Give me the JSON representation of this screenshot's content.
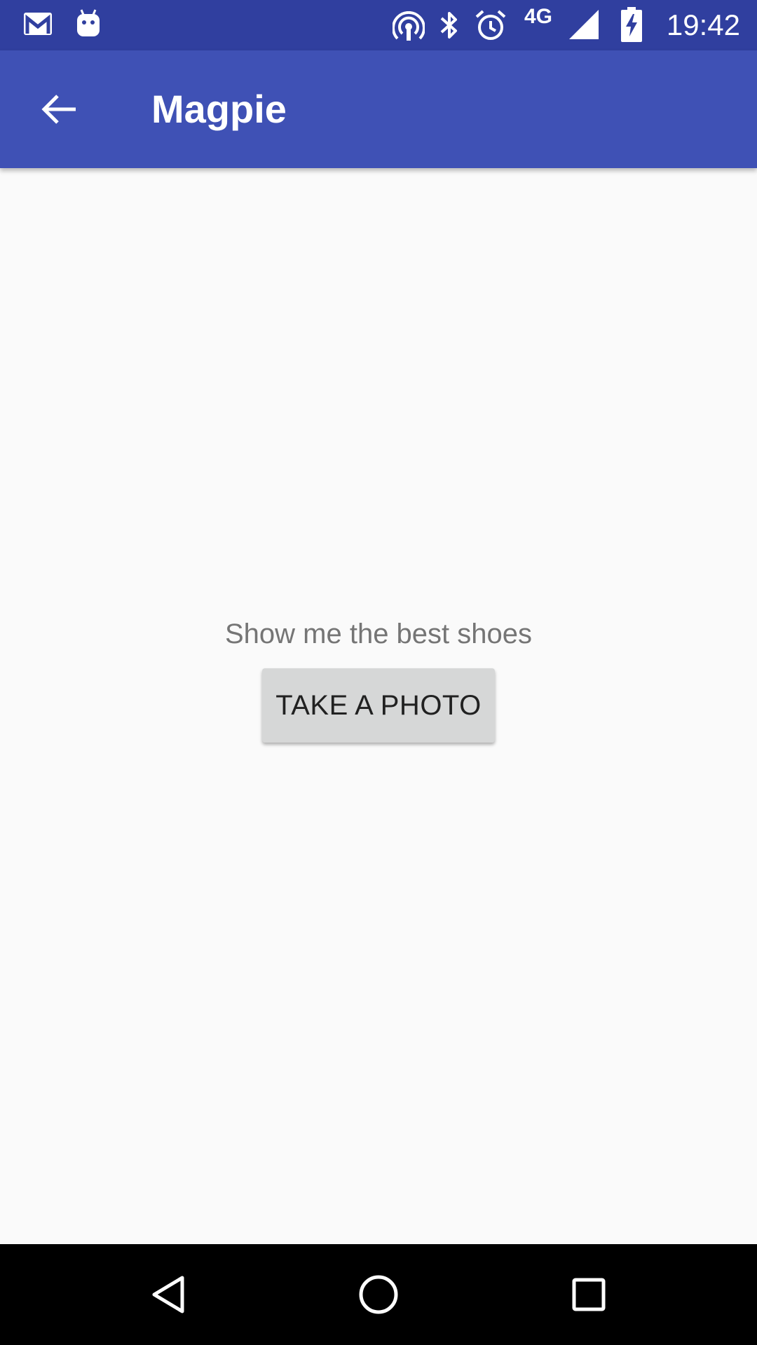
{
  "status_bar": {
    "time": "19:42",
    "network_label": "4G",
    "icons": [
      "gmail-icon",
      "android-debug-icon",
      "hotspot-icon",
      "bluetooth-icon",
      "alarm-icon",
      "signal-icon",
      "battery-charging-icon"
    ]
  },
  "app_bar": {
    "title": "Magpie",
    "back_icon": "arrow-back-icon"
  },
  "main": {
    "prompt": "Show me the best shoes",
    "button_label": "TAKE A PHOTO"
  },
  "nav_bar": {
    "icons": [
      "back-triangle-icon",
      "home-circle-icon",
      "recents-square-icon"
    ]
  },
  "colors": {
    "status_bar": "#303f9f",
    "app_bar": "#3f51b5",
    "background": "#fafafa",
    "button": "#d6d7d7",
    "prompt_text": "#757575"
  }
}
